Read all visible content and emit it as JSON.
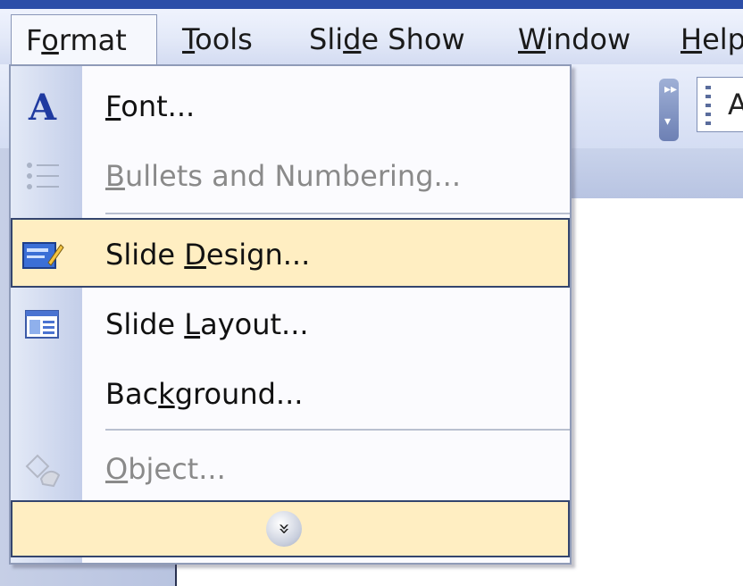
{
  "menubar": {
    "items": [
      {
        "label": "Format",
        "mnemonic": "o"
      },
      {
        "label": "Tools",
        "mnemonic": "T"
      },
      {
        "label": "Slide Show",
        "mnemonic": "d"
      },
      {
        "label": "Window",
        "mnemonic": "W"
      },
      {
        "label": "Help",
        "mnemonic": "H"
      }
    ]
  },
  "toolbar": {
    "combo_text": "A"
  },
  "format_menu": {
    "items": [
      {
        "label": "Font...",
        "mnemonic": "F",
        "icon": "font-a-icon",
        "enabled": true,
        "highlighted": false
      },
      {
        "label": "Bullets and Numbering...",
        "mnemonic": "B",
        "icon": "bullets-icon",
        "enabled": false,
        "highlighted": false
      },
      {
        "label": "Slide Design...",
        "mnemonic": "D",
        "icon": "slide-design-icon",
        "enabled": true,
        "highlighted": true
      },
      {
        "label": "Slide Layout...",
        "mnemonic": "L",
        "icon": "slide-layout-icon",
        "enabled": true,
        "highlighted": false
      },
      {
        "label": "Background...",
        "mnemonic": "k",
        "icon": "",
        "enabled": true,
        "highlighted": false
      },
      {
        "label": "Object...",
        "mnemonic": "O",
        "icon": "object-icon",
        "enabled": false,
        "highlighted": false
      }
    ],
    "expand_glyph": "»"
  },
  "colors": {
    "highlight_bg": "#ffeec2",
    "highlight_border": "#34456e",
    "disabled_text": "#8a8a8a"
  }
}
